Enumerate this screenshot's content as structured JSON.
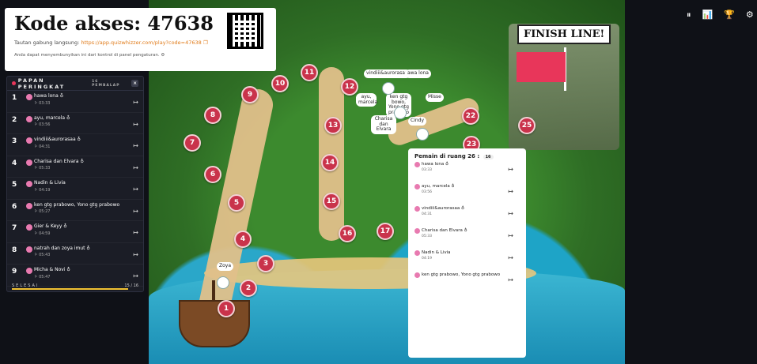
{
  "access": {
    "title": "Kode akses: 47638",
    "link_label": "Tautan gabung langsung:",
    "link_url": "https://app.quizwhizzer.com/play?code=47638",
    "sound_note": "Anda dapat menyembunyikan ini dari kontrol di panel pengaturan."
  },
  "map": {
    "finish_label": "FINISH LINE!",
    "nodes": [
      "1",
      "2",
      "3",
      "4",
      "5",
      "6",
      "7",
      "8",
      "9",
      "10",
      "11",
      "12",
      "13",
      "14",
      "15",
      "16",
      "17",
      "22",
      "23",
      "25"
    ],
    "bubbles": {
      "zoya": "Zoya",
      "vindiii": "vindiii&aurorasaa",
      "hawa": "awa lona",
      "ayu": "ayu, marcela",
      "ken": "ken gtg bowo, Yono gtg prabowo",
      "misse": "Misse",
      "charisa": "Charisa dan Elvara",
      "cindy": "Cindy"
    }
  },
  "leaderboard": {
    "title": "PAPAN PERINGKAT",
    "count": "16 PEMBALAP",
    "close": "×",
    "rows": [
      {
        "rank": "1",
        "name": "hawa lona ♁",
        "time": "03:33"
      },
      {
        "rank": "2",
        "name": "ayu, marcela ♁",
        "time": "03:56"
      },
      {
        "rank": "3",
        "name": "vindiii&aurorasaa ♁",
        "time": "04:31"
      },
      {
        "rank": "4",
        "name": "Charisa dan Elvara ♁",
        "time": "05:33"
      },
      {
        "rank": "5",
        "name": "Nadin & Livia",
        "time": "04:19"
      },
      {
        "rank": "6",
        "name": "ken gtg prabowo, Yono gtg prabowo",
        "time": "05:27"
      },
      {
        "rank": "7",
        "name": "Gier & Keyy ♁",
        "time": "04:59"
      },
      {
        "rank": "8",
        "name": "natrah dan zoya imut ♁",
        "time": "05:43"
      },
      {
        "rank": "9",
        "name": "Micha & Novi ♁",
        "time": "05:47"
      }
    ],
    "done_label": "SELESAI",
    "done_value": "15 / 16",
    "done_fraction": 0.9375,
    "kick_icon": "↦"
  },
  "room": {
    "title": "Pemain di ruang 26 :",
    "badge": "16",
    "players": [
      {
        "name": "hawa lona ♁",
        "time": "03:33"
      },
      {
        "name": "ayu, marcela ♁",
        "time": "03:56"
      },
      {
        "name": "vindiii&aurorasaa ♁",
        "time": "04:31"
      },
      {
        "name": "Charisa dan Elvara ♁",
        "time": "05:33"
      },
      {
        "name": "Nadin & Livia",
        "time": "04:19"
      },
      {
        "name": "ken gtg prabowo, Yono gtg prabowo",
        "time": ""
      }
    ]
  },
  "toolbar": {
    "icons": [
      "pause-icon",
      "chart-icon",
      "trophy-icon",
      "gear-icon"
    ],
    "glyphs": [
      "⏸",
      "📊",
      "🏆",
      "⚙"
    ]
  }
}
